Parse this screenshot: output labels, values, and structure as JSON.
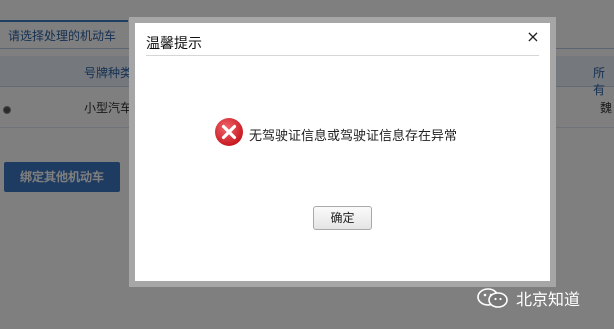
{
  "background": {
    "tab_label": "请选择处理的机动车",
    "table": {
      "headers": [
        "号牌种类",
        "所有"
      ],
      "row": [
        "小型汽车",
        "魏"
      ]
    },
    "bind_button_label": "绑定其他机动车"
  },
  "dialog": {
    "title": "温馨提示",
    "close_symbol": "×",
    "icon": "error-x-icon",
    "message": "无驾驶证信息或驾驶证信息存在异常",
    "ok_label": "确定"
  },
  "watermark": {
    "icon": "wechat-icon",
    "text": "北京知道"
  },
  "colors": {
    "accent": "#3b7fc4",
    "error": "#d9282f"
  }
}
